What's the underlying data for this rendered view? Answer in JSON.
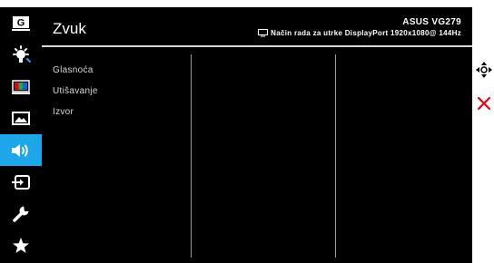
{
  "osd": {
    "title": "Zvuk",
    "model": "ASUS VG279",
    "mode": "Način rada za utrke DisplayPort 1920x1080@ 144Hz",
    "mode_icon": "monitor-icon"
  },
  "sidebar": {
    "items": [
      {
        "icon": "gameplus-icon"
      },
      {
        "icon": "blue-light-filter-icon"
      },
      {
        "icon": "color-icon"
      },
      {
        "icon": "image-icon"
      },
      {
        "icon": "sound-icon",
        "active": true
      },
      {
        "icon": "input-select-icon"
      },
      {
        "icon": "system-setup-icon"
      },
      {
        "icon": "my-favorite-icon"
      }
    ],
    "active_color": "#1ea7e8"
  },
  "menu": {
    "items": [
      {
        "label": "Glasnoća"
      },
      {
        "label": "Utišavanje"
      },
      {
        "label": "Izvor"
      }
    ]
  },
  "controls": {
    "navigate_icon": "navigate-icon",
    "exit_icon": "close-icon",
    "exit_color": "#e60012"
  }
}
